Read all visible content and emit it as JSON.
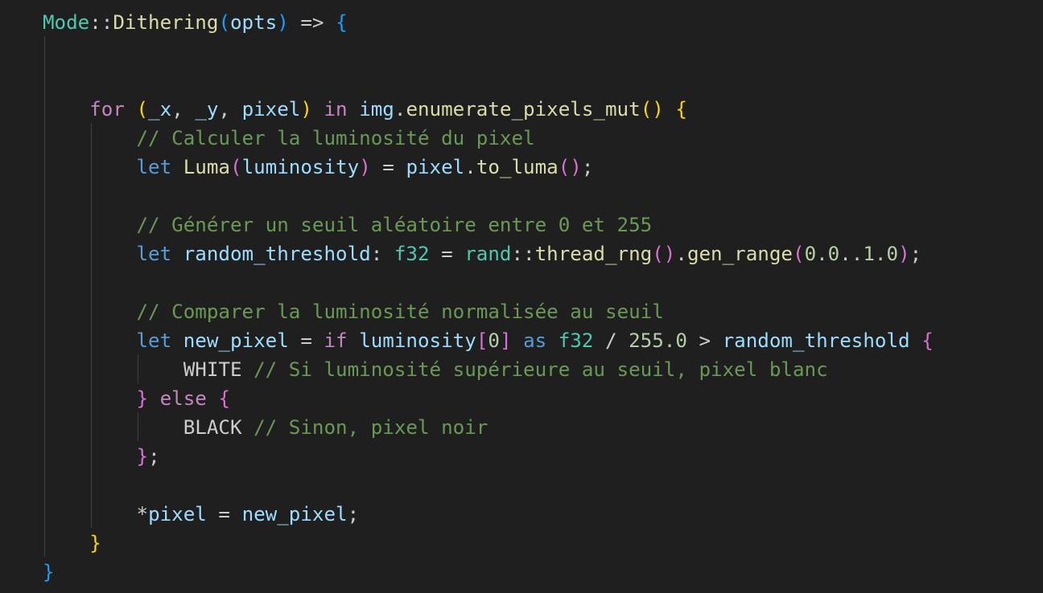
{
  "editor": {
    "theme": {
      "background": "#1f1f1f",
      "default": "#cccccc",
      "keyword": "#c586c0",
      "storage": "#569cd6",
      "function": "#dcdcaa",
      "type": "#4ec9b0",
      "variable": "#9cdcfe",
      "comment": "#6a9955",
      "number": "#b5cea8",
      "constant": "#4fc1ff",
      "bracket1": "#ffd700",
      "bracket2": "#da70d6",
      "bracket3": "#179fff"
    },
    "lines": [
      [
        {
          "t": "Mode",
          "k": "type"
        },
        {
          "t": "::",
          "k": "default"
        },
        {
          "t": "Dithering",
          "k": "function"
        },
        {
          "t": "(",
          "k": "bracket3"
        },
        {
          "t": "opts",
          "k": "variable"
        },
        {
          "t": ")",
          "k": "bracket3"
        },
        {
          "t": " => ",
          "k": "default"
        },
        {
          "t": "{",
          "k": "bracket3"
        }
      ],
      [],
      [],
      [
        {
          "t": "    ",
          "k": "default"
        },
        {
          "t": "for",
          "k": "keyword"
        },
        {
          "t": " ",
          "k": "default"
        },
        {
          "t": "(",
          "k": "bracket1"
        },
        {
          "t": "_x",
          "k": "variable"
        },
        {
          "t": ", ",
          "k": "default"
        },
        {
          "t": "_y",
          "k": "variable"
        },
        {
          "t": ", ",
          "k": "default"
        },
        {
          "t": "pixel",
          "k": "variable"
        },
        {
          "t": ")",
          "k": "bracket1"
        },
        {
          "t": " ",
          "k": "default"
        },
        {
          "t": "in",
          "k": "keyword"
        },
        {
          "t": " ",
          "k": "default"
        },
        {
          "t": "img",
          "k": "variable"
        },
        {
          "t": ".",
          "k": "default"
        },
        {
          "t": "enumerate_pixels_mut",
          "k": "function"
        },
        {
          "t": "()",
          "k": "bracket1"
        },
        {
          "t": " ",
          "k": "default"
        },
        {
          "t": "{",
          "k": "bracket1"
        }
      ],
      [
        {
          "t": "        ",
          "k": "default"
        },
        {
          "t": "// Calculer la luminosité du pixel",
          "k": "comment"
        }
      ],
      [
        {
          "t": "        ",
          "k": "default"
        },
        {
          "t": "let",
          "k": "storage"
        },
        {
          "t": " ",
          "k": "default"
        },
        {
          "t": "Luma",
          "k": "function"
        },
        {
          "t": "(",
          "k": "bracket2"
        },
        {
          "t": "luminosity",
          "k": "variable"
        },
        {
          "t": ")",
          "k": "bracket2"
        },
        {
          "t": " = ",
          "k": "default"
        },
        {
          "t": "pixel",
          "k": "variable"
        },
        {
          "t": ".",
          "k": "default"
        },
        {
          "t": "to_luma",
          "k": "function"
        },
        {
          "t": "()",
          "k": "bracket2"
        },
        {
          "t": ";",
          "k": "default"
        }
      ],
      [],
      [
        {
          "t": "        ",
          "k": "default"
        },
        {
          "t": "// Générer un seuil aléatoire entre 0 et 255",
          "k": "comment"
        }
      ],
      [
        {
          "t": "        ",
          "k": "default"
        },
        {
          "t": "let",
          "k": "storage"
        },
        {
          "t": " ",
          "k": "default"
        },
        {
          "t": "random_threshold",
          "k": "variable"
        },
        {
          "t": ": ",
          "k": "default"
        },
        {
          "t": "f32",
          "k": "type"
        },
        {
          "t": " = ",
          "k": "default"
        },
        {
          "t": "rand",
          "k": "type"
        },
        {
          "t": "::",
          "k": "default"
        },
        {
          "t": "thread_rng",
          "k": "function"
        },
        {
          "t": "()",
          "k": "bracket2"
        },
        {
          "t": ".",
          "k": "default"
        },
        {
          "t": "gen_range",
          "k": "function"
        },
        {
          "t": "(",
          "k": "bracket2"
        },
        {
          "t": "0.0",
          "k": "number"
        },
        {
          "t": "..",
          "k": "default"
        },
        {
          "t": "1.0",
          "k": "number"
        },
        {
          "t": ")",
          "k": "bracket2"
        },
        {
          "t": ";",
          "k": "default"
        }
      ],
      [],
      [
        {
          "t": "        ",
          "k": "default"
        },
        {
          "t": "// Comparer la luminosité normalisée au seuil",
          "k": "comment"
        }
      ],
      [
        {
          "t": "        ",
          "k": "default"
        },
        {
          "t": "let",
          "k": "storage"
        },
        {
          "t": " ",
          "k": "default"
        },
        {
          "t": "new_pixel",
          "k": "variable"
        },
        {
          "t": " = ",
          "k": "default"
        },
        {
          "t": "if",
          "k": "keyword"
        },
        {
          "t": " ",
          "k": "default"
        },
        {
          "t": "luminosity",
          "k": "variable"
        },
        {
          "t": "[",
          "k": "bracket2"
        },
        {
          "t": "0",
          "k": "number"
        },
        {
          "t": "]",
          "k": "bracket2"
        },
        {
          "t": " ",
          "k": "default"
        },
        {
          "t": "as",
          "k": "storage"
        },
        {
          "t": " ",
          "k": "default"
        },
        {
          "t": "f32",
          "k": "type"
        },
        {
          "t": " / ",
          "k": "default"
        },
        {
          "t": "255.0",
          "k": "number"
        },
        {
          "t": " > ",
          "k": "default"
        },
        {
          "t": "random_threshold",
          "k": "variable"
        },
        {
          "t": " ",
          "k": "default"
        },
        {
          "t": "{",
          "k": "bracket2"
        }
      ],
      [
        {
          "t": "            ",
          "k": "default"
        },
        {
          "t": "WHITE",
          "k": "default"
        },
        {
          "t": " ",
          "k": "default"
        },
        {
          "t": "// Si luminosité supérieure au seuil, pixel blanc",
          "k": "comment"
        }
      ],
      [
        {
          "t": "        ",
          "k": "default"
        },
        {
          "t": "}",
          "k": "bracket2"
        },
        {
          "t": " ",
          "k": "default"
        },
        {
          "t": "else",
          "k": "keyword"
        },
        {
          "t": " ",
          "k": "default"
        },
        {
          "t": "{",
          "k": "bracket2"
        }
      ],
      [
        {
          "t": "            ",
          "k": "default"
        },
        {
          "t": "BLACK",
          "k": "default"
        },
        {
          "t": " ",
          "k": "default"
        },
        {
          "t": "// Sinon, pixel noir",
          "k": "comment"
        }
      ],
      [
        {
          "t": "        ",
          "k": "default"
        },
        {
          "t": "}",
          "k": "bracket2"
        },
        {
          "t": ";",
          "k": "default"
        }
      ],
      [],
      [
        {
          "t": "        ",
          "k": "default"
        },
        {
          "t": "*",
          "k": "default"
        },
        {
          "t": "pixel",
          "k": "variable"
        },
        {
          "t": " = ",
          "k": "default"
        },
        {
          "t": "new_pixel",
          "k": "variable"
        },
        {
          "t": ";",
          "k": "default"
        }
      ],
      [
        {
          "t": "    ",
          "k": "default"
        },
        {
          "t": "}",
          "k": "bracket1"
        }
      ],
      [
        {
          "t": "}",
          "k": "bracket3"
        }
      ]
    ]
  }
}
